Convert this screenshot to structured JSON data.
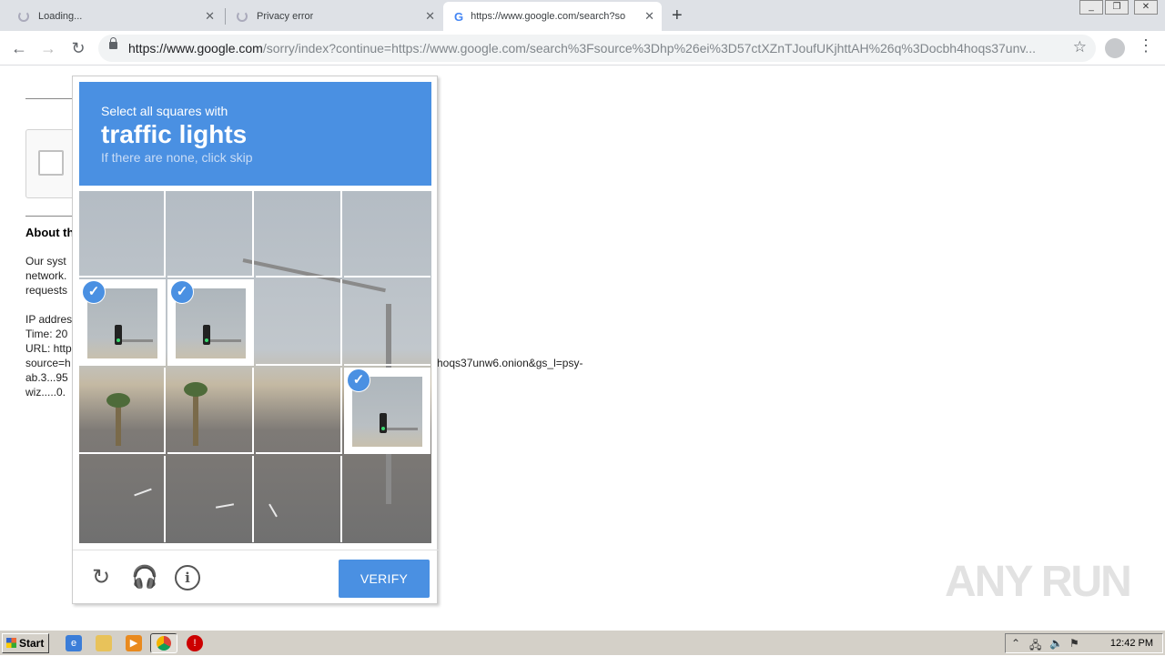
{
  "browser": {
    "tabs": [
      {
        "title": "Loading...",
        "state": "loading"
      },
      {
        "title": "Privacy error",
        "state": "loading"
      },
      {
        "title": "https://www.google.com/search?sou",
        "state": "active"
      }
    ],
    "new_tab_symbol": "+",
    "window_controls": [
      "minimize-icon",
      "restore-icon",
      "close-icon"
    ],
    "url_host": "https://www.google.com",
    "url_rest": "/sorry/index?continue=https://www.google.com/search%3Fsource%3Dhp%26ei%3D57ctXZnTJoufUKjhttAH%26q%3Docbh4hoqs37unv...",
    "nav_icons": {
      "back": "arrow-left-icon",
      "forward": "arrow-right-icon",
      "reload": "reload-icon"
    }
  },
  "page": {
    "about_title": "About th",
    "lines_para1": [
      "Our syst",
      "network.",
      "requests"
    ],
    "lines_para2": [
      "IP addres",
      "Time: 20",
      "URL: http",
      "source=h",
      "ab.3...95",
      "wiz.....0."
    ],
    "url_tail": "hoqs37unw6.onion&gs_l=psy-"
  },
  "challenge": {
    "instruction": "Select all squares with",
    "target": "traffic lights",
    "hint": "If there are none, click skip",
    "grid_rows": 4,
    "grid_cols": 4,
    "selected_tiles": [
      4,
      5,
      11
    ],
    "check_mark": "✓",
    "verify_label": "VERIFY",
    "footer_icons": [
      "reload-icon",
      "headphones-icon",
      "info-icon"
    ],
    "colors": {
      "accent": "#4a90e2"
    }
  },
  "watermark": "ANY RUN",
  "taskbar": {
    "start_label": "Start",
    "apps": [
      "internet-explorer-icon",
      "folder-icon",
      "media-player-icon",
      "chrome-icon",
      "stop-icon"
    ],
    "clock": "12:42 PM"
  }
}
